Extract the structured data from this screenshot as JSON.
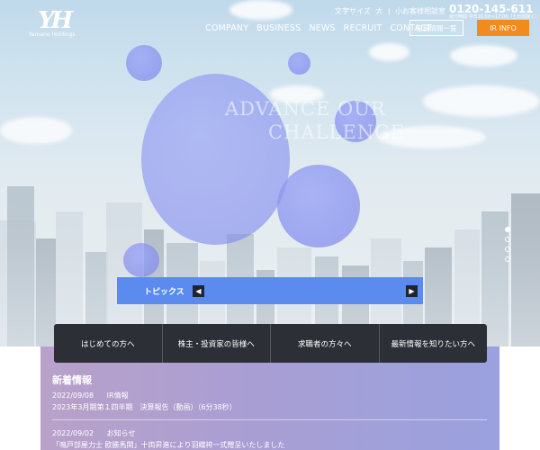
{
  "header": {
    "logo_text": "Yamano Holdings",
    "font_size_label": "文字サイズ",
    "font_size_large": "大",
    "font_size_small": "小",
    "phone_label": "お客様相談室",
    "phone_number": "0120-145-611",
    "phone_hours": "受付時間 平日10:00〜17:00（土日祝除く）",
    "store_button": "店舗情報一覧",
    "ir_button": "IR INFO"
  },
  "nav": {
    "items": [
      "COMPANY",
      "BUSINESS",
      "NEWS",
      "RECRUIT",
      "CONTACT"
    ]
  },
  "hero": {
    "line1": "ADVANCE OUR",
    "line2": "CHALLENGE",
    "slides": 4,
    "active_slide": 1
  },
  "topics": {
    "label": "トピックス",
    "prev_icon": "chevron-left-icon",
    "next_icon": "chevron-right-icon"
  },
  "audience": {
    "items": [
      "はじめての方へ",
      "株主・投資家の皆様へ",
      "求職者の方々へ",
      "最新情報を知りたい方へ"
    ]
  },
  "news": {
    "title": "新着情報",
    "items": [
      {
        "date": "2022/09/08",
        "category": "IR情報",
        "text": "2023年3月期第１四半期　決算報告（動画）（6分38秒）"
      },
      {
        "date": "2022/09/02",
        "category": "お知らせ",
        "text": "「鳴戸部屋力士 欧勝馬関」十両昇進により羽織袴一式贈呈いたしました"
      }
    ]
  },
  "colors": {
    "accent_orange": "#f28a1c",
    "topics_blue": "#5b8bee",
    "audience_dark": "#2c2f36",
    "bubble_purple": "#8f98ee"
  }
}
